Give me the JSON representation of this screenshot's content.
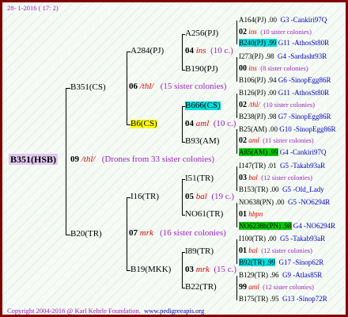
{
  "header": {
    "date": "28- 1-2016 ( 17: 2)"
  },
  "footer": {
    "copyright": "Copyright 2004-2016 @ Karl Kehrle Foundation.",
    "url": "www.pedigreeapis.org"
  },
  "colors": {
    "border": "#800000",
    "root_bg": "#e2c8f0",
    "cyan": "#00e0e0",
    "yellow": "#ffff00",
    "green": "#00cc00",
    "red": "#e00000",
    "purple": "#a020c0",
    "blue": "#0000c0"
  },
  "root": {
    "label": "B351(HSB)",
    "year": "09",
    "mark": "/thl/",
    "note": "(Drones from 33 sister colonies)"
  },
  "upper": {
    "queen": "B351(CS)",
    "year": "06",
    "mark": "/thl/",
    "note": "(15 sister colonies)",
    "a": {
      "queen": "A284(PJ)",
      "year": "04",
      "mark": "ins",
      "note": "(10 c.)",
      "a": {
        "queen": "A256(PJ)",
        "g1": {
          "label": "A164(PJ)",
          "mid": ".00",
          "code": "G3 -Cankiri97Q"
        },
        "y": "02",
        "m": "ins",
        "n": "(10 sister colonies)",
        "g2": {
          "label": "B240(PJ)",
          "mid": ".99",
          "code": "G11 -AthosSt80R"
        }
      },
      "b": {
        "queen": "B190(PJ)",
        "g1": {
          "label": "I273(PJ)",
          "mid": ".98",
          "code": "G4 -Sardasht93R"
        },
        "y": "00",
        "m": "ins",
        "n": "(8 sister colonies)",
        "g2": {
          "label": "B106(PJ)",
          "mid": ".94",
          "code": "G6 -SinopEgg86R"
        }
      }
    },
    "b": {
      "queen": "B6(CS)",
      "year": "04",
      "mark": "aml",
      "note": "(10 c.)",
      "a": {
        "queen": "B666(CS)",
        "g1": {
          "label": "B126(PJ)",
          "mid": ".00",
          "code": "G11 -AthosSt80R"
        },
        "y": "02",
        "m": "/thl/",
        "n": "(10 sister colonies)",
        "g2": {
          "label": "B238(PJ)",
          "mid": ".98",
          "code": "G7 -SinopEgg86R"
        }
      },
      "b": {
        "queen": "B93(AM)",
        "g1": {
          "label": "B25(AM)",
          "mid": ".00",
          "code": "G10 -SinopEgg86R"
        },
        "y": "02",
        "m": "aml",
        "n": "(11 sister colonies)",
        "g2": {
          "label": "A85(AM)",
          "mid": ".99",
          "code": "G4 -Cankiri97Q"
        }
      }
    }
  },
  "lower": {
    "queen": "B20(TR)",
    "year": "07",
    "mark": "mrk",
    "note": "(16 sister colonies)",
    "a": {
      "queen": "I16(TR)",
      "year": "05",
      "mark": "bal",
      "note": "(19 c.)",
      "a": {
        "queen": "I51(TR)",
        "g1": {
          "label": "I147(TR)",
          "mid": ".01",
          "code": "G5 -Takab93aR"
        },
        "y": "03",
        "m": "bal",
        "n": "(12 sister colonies)",
        "g2": {
          "label": "B153(TR)",
          "mid": ".00",
          "code": "G5 -Old_Lady"
        }
      },
      "b": {
        "queen": "NO61(TR)",
        "g1": {
          "label": "NO638(PN)",
          "mid": ".00",
          "code": "G5 -NO6294R"
        },
        "y": "01",
        "m": "hbpn",
        "n": "",
        "g2": {
          "label": "NO6238b(PN)",
          "mid": ".98",
          "code": "G4 -NO6294R"
        }
      }
    },
    "b": {
      "queen": "B19(MKK)",
      "year": "03",
      "mark": "mrk",
      "note": "(15 c.)",
      "a": {
        "queen": "I89(TR)",
        "g1": {
          "label": "I100(TR)",
          "mid": ".00",
          "code": "G5 -Takab93aR"
        },
        "y": "01",
        "m": "bal",
        "n": "(12 sister colonies)",
        "g2": {
          "label": "B92(TR)",
          "mid": ".99",
          "code": "G17 -Sinop62R"
        }
      },
      "b": {
        "queen": "B22(TR)",
        "g1": {
          "label": "B129(TR)",
          "mid": ".96",
          "code": "G9 -Atlas85R"
        },
        "y": "99",
        "m": "aml",
        "n": "(12 sister colonies)",
        "g2": {
          "label": "B175(TR)",
          "mid": ".95",
          "code": "G13 -Sinop72R"
        }
      }
    }
  }
}
